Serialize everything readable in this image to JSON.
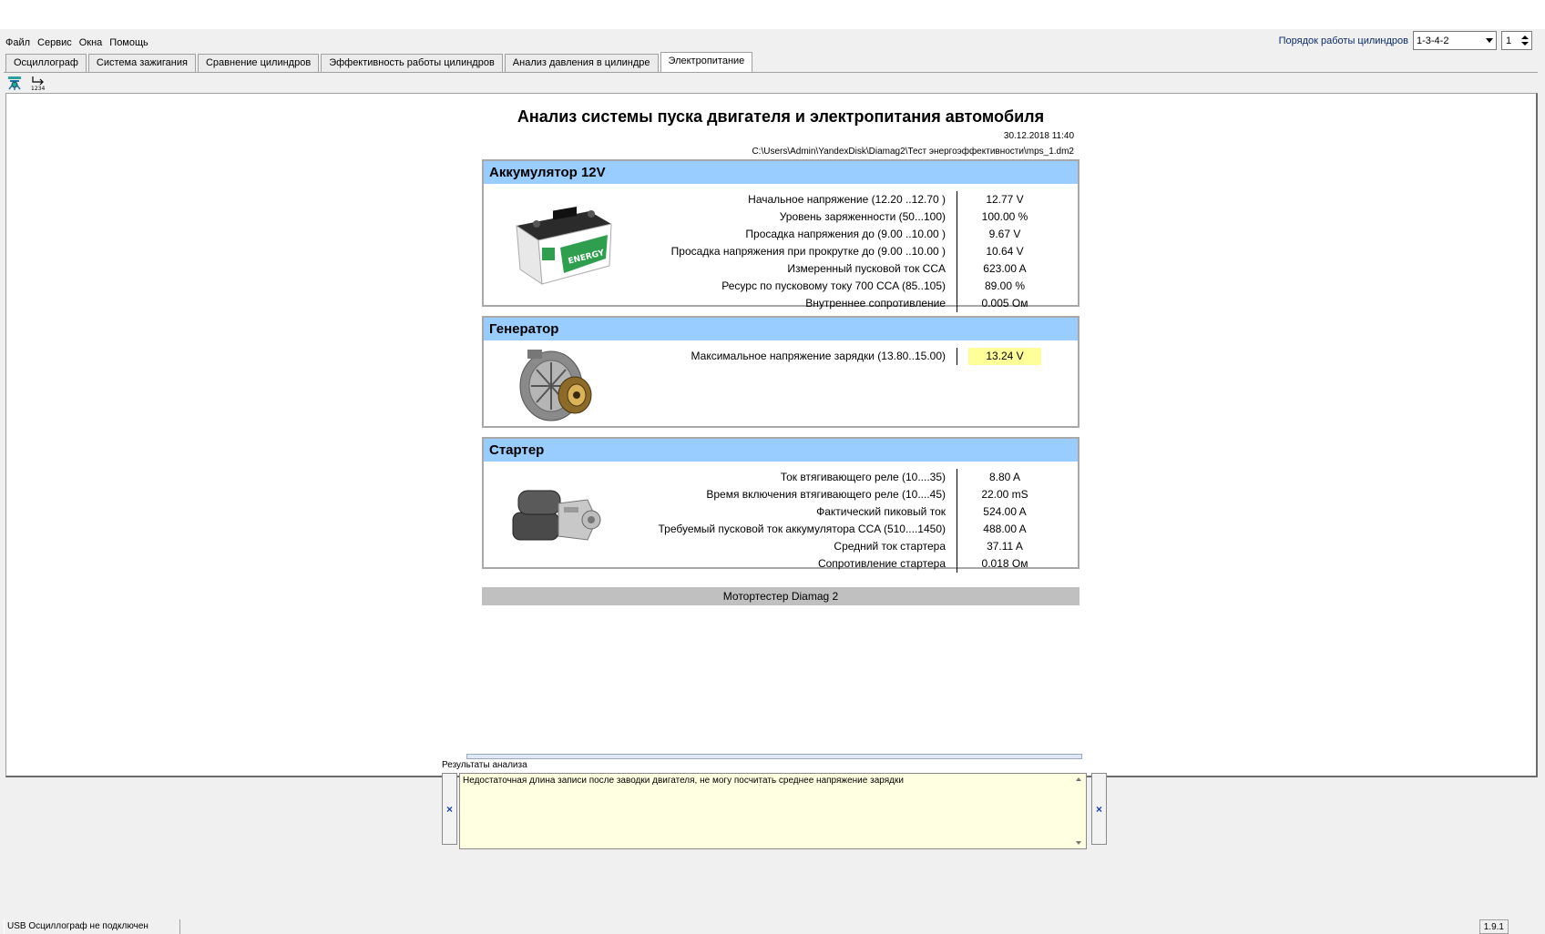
{
  "menu": [
    "Файл",
    "Сервис",
    "Окна",
    "Помощь"
  ],
  "cylinder_order": {
    "label": "Порядок работы цилиндров",
    "value": "1-3-4-2",
    "spin_value": "1"
  },
  "tabs": [
    {
      "label": "Осциллограф",
      "active": false
    },
    {
      "label": "Система зажигания",
      "active": false
    },
    {
      "label": "Сравнение цилиндров",
      "active": false
    },
    {
      "label": "Эффективность работы цилиндров",
      "active": false
    },
    {
      "label": "Анализ давления в цилиндре",
      "active": false
    },
    {
      "label": "Электропитание",
      "active": true
    }
  ],
  "toolbar": {
    "icons": [
      "settings-tree-icon",
      "sequence-1234-icon"
    ],
    "seq_caption": "1234"
  },
  "report": {
    "title": "Анализ системы пуска двигателя и электропитания автомобиля",
    "date": "30.12.2018 11:40",
    "path": "C:\\Users\\Admin\\YandexDisk\\Diamag2\\Тест энергоэффективности\\mps_1.dm2",
    "battery": {
      "title": "Аккумулятор 12V",
      "image_label": "ENERGY",
      "rows": [
        {
          "k": "Начальное напряжение (12.20 ..12.70 )",
          "v": "12.77 V"
        },
        {
          "k": "Уровень заряженности (50...100)",
          "v": "100.00 %"
        },
        {
          "k": "Просадка напряжения до (9.00 ..10.00 )",
          "v": "9.67 V"
        },
        {
          "k": "Просадка напряжения при прокрутке до (9.00 ..10.00 )",
          "v": "10.64 V"
        },
        {
          "k": "Измеренный пусковой ток  CCA",
          "v": "623.00 A"
        },
        {
          "k": "Ресурс по пусковому току  700 CCA (85..105)",
          "v": "89.00 %"
        },
        {
          "k": "Внутреннее сопротивление",
          "v": "0.005 Ом"
        }
      ]
    },
    "generator": {
      "title": "Генератор",
      "rows": [
        {
          "k": "Максимальное напряжение зарядки  (13.80..15.00)",
          "v": "13.24 V",
          "warn": true
        }
      ]
    },
    "starter": {
      "title": "Стартер",
      "rows": [
        {
          "k": "Ток втягивающего реле (10....35)",
          "v": "8.80 A"
        },
        {
          "k": "Время включения втягивающего реле (10....45)",
          "v": "22.00 mS"
        },
        {
          "k": "Фактический пиковый ток",
          "v": "524.00 A"
        },
        {
          "k": "Требуемый пусковой ток аккумулятора  CCA (510....1450)",
          "v": "488.00 A"
        },
        {
          "k": "Средний ток стартера",
          "v": "37.11 A"
        },
        {
          "k": "Сопротивление стартера",
          "v": "0.018 Ом"
        }
      ]
    },
    "footer": "Мотортестер Diamag 2"
  },
  "results": {
    "label": "Результаты анализа",
    "message": "Недостаточная длина записи после заводки двигателя, не могу посчитать среднее напряжение зарядки",
    "close_glyph": "×"
  },
  "status": {
    "left": "USB Осциллограф не подключен",
    "version": "1.9.1"
  },
  "colors": {
    "panel_header": "#99ccff",
    "warning_value": "#ffff99",
    "results_bg": "#ffffe1"
  }
}
